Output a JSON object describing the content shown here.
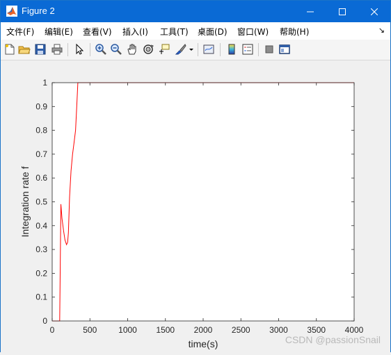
{
  "window": {
    "title": "Figure 2",
    "accent": "#0a6ad5"
  },
  "menu": {
    "items": [
      {
        "label": "文件(F)",
        "name": "menu-file"
      },
      {
        "label": "编辑(E)",
        "name": "menu-edit"
      },
      {
        "label": "查看(V)",
        "name": "menu-view"
      },
      {
        "label": "插入(I)",
        "name": "menu-insert"
      },
      {
        "label": "工具(T)",
        "name": "menu-tools"
      },
      {
        "label": "桌面(D)",
        "name": "menu-desktop"
      },
      {
        "label": "窗口(W)",
        "name": "menu-window"
      },
      {
        "label": "帮助(H)",
        "name": "menu-help"
      }
    ],
    "overflow": "↘"
  },
  "toolbar": {
    "icons": [
      "new-figure-icon",
      "open-file-icon",
      "save-icon",
      "print-icon",
      "pointer-icon",
      "zoom-in-icon",
      "zoom-out-icon",
      "pan-icon",
      "rotate-3d-icon",
      "data-cursor-icon",
      "brush-icon",
      "link-plot-icon",
      "colorbar-icon",
      "legend-icon",
      "hide-plot-tools-icon",
      "show-plot-tools-icon"
    ]
  },
  "chart_data": {
    "type": "line",
    "xlabel": "time(s)",
    "ylabel": "Integration rate f",
    "xlim": [
      0,
      4000
    ],
    "ylim": [
      0,
      1
    ],
    "xticks": [
      "0",
      "500",
      "1000",
      "1500",
      "2000",
      "2500",
      "3000",
      "3500",
      "4000"
    ],
    "yticks": [
      "0",
      "0.1",
      "0.2",
      "0.3",
      "0.4",
      "0.5",
      "0.6",
      "0.7",
      "0.8",
      "0.9",
      "1"
    ],
    "grid": false,
    "series": [
      {
        "color": "#ff0000",
        "x": [
          0,
          100,
          115,
          130,
          150,
          170,
          190,
          205,
          215,
          230,
          250,
          270,
          290,
          310,
          325,
          340,
          360,
          500,
          4000
        ],
        "y": [
          0,
          0,
          0.49,
          0.43,
          0.38,
          0.34,
          0.32,
          0.33,
          0.37,
          0.52,
          0.63,
          0.7,
          0.75,
          0.8,
          0.9,
          1.0,
          1.0,
          1.0,
          1.0
        ]
      }
    ]
  },
  "watermark": "CSDN @passionSnail"
}
